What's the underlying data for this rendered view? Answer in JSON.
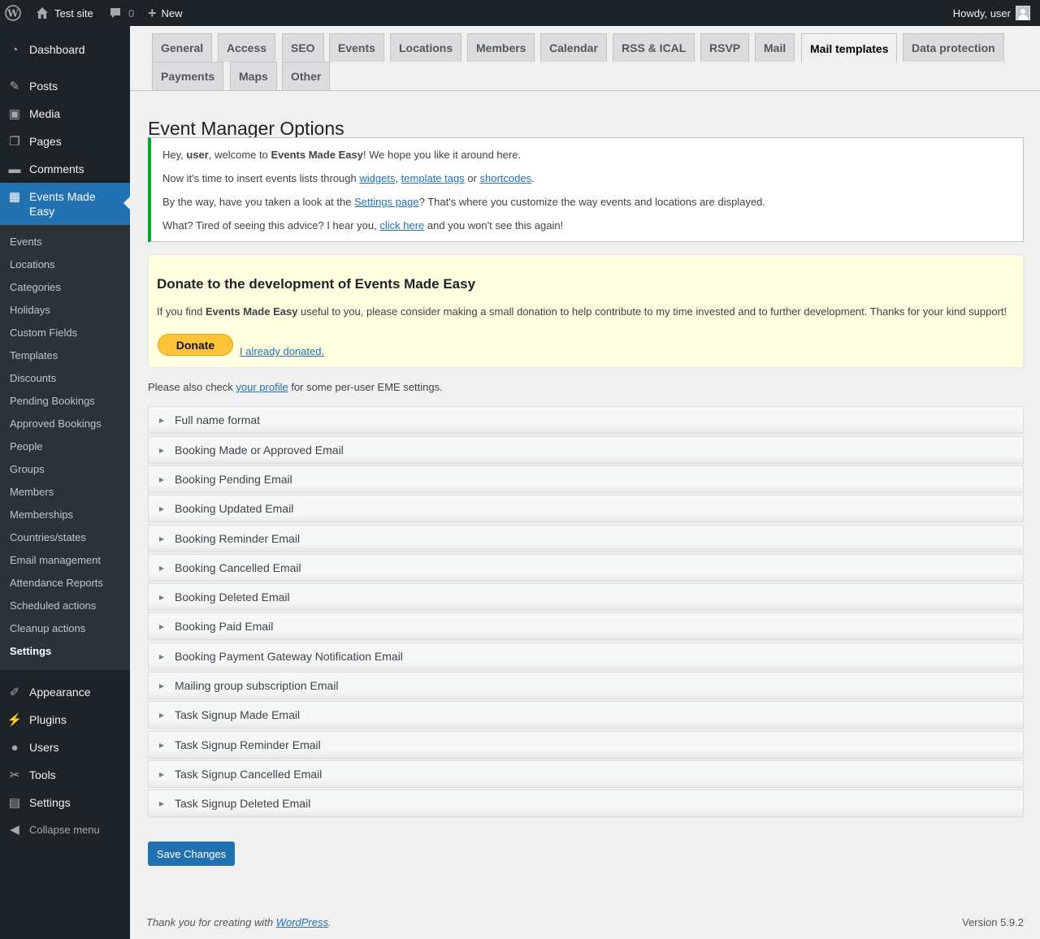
{
  "adminbar": {
    "site_name": "Test site",
    "comments_count": "0",
    "new_label": "New",
    "howdy": "Howdy, user"
  },
  "sidebar": {
    "dashboard": "Dashboard",
    "posts": "Posts",
    "media": "Media",
    "pages": "Pages",
    "comments": "Comments",
    "events_made_easy": "Events Made Easy",
    "submenu": [
      "Events",
      "Locations",
      "Categories",
      "Holidays",
      "Custom Fields",
      "Templates",
      "Discounts",
      "Pending Bookings",
      "Approved Bookings",
      "People",
      "Groups",
      "Members",
      "Memberships",
      "Countries/states",
      "Email management",
      "Attendance Reports",
      "Scheduled actions",
      "Cleanup actions",
      "Settings"
    ],
    "appearance": "Appearance",
    "plugins": "Plugins",
    "users": "Users",
    "tools": "Tools",
    "settings": "Settings",
    "collapse": "Collapse menu"
  },
  "tabs": [
    "General",
    "Access",
    "SEO",
    "Events",
    "Locations",
    "Members",
    "Calendar",
    "RSS & ICAL",
    "RSVP",
    "Mail",
    "Mail templates",
    "Data protection",
    "Payments",
    "Maps",
    "Other"
  ],
  "active_tab": "Mail templates",
  "page_title": "Event Manager Options",
  "notice": {
    "l1_a": "Hey, ",
    "l1_user": "user",
    "l1_b": ", welcome to ",
    "l1_plugin": "Events Made Easy",
    "l1_c": "! We hope you like it around here.",
    "l2_a": "Now it's time to insert events lists through ",
    "l2_link1": "widgets",
    "l2_sep1": ", ",
    "l2_link2": "template tags",
    "l2_sep2": " or ",
    "l2_link3": "shortcodes",
    "l2_end": ".",
    "l3_a": "By the way, have you taken a look at the ",
    "l3_link": "Settings page",
    "l3_b": "? That's where you customize the way events and locations are displayed.",
    "l4_a": "What? Tired of seeing this advice? I hear you, ",
    "l4_link": "click here",
    "l4_b": " and you won't see this again!"
  },
  "donate": {
    "heading": "Donate to the development of Events Made Easy",
    "text_a": "If you find ",
    "text_bold": "Events Made Easy",
    "text_b": " useful to you, please consider making a small donation to help contribute to my time invested and to further development. Thanks for your kind support!",
    "button": "Donate",
    "already": "I already donated."
  },
  "profile_note": {
    "a": "Please also check ",
    "link": "your profile",
    "b": " for some per-user EME settings."
  },
  "sections": [
    "Full name format",
    "Booking Made or Approved Email",
    "Booking Pending Email",
    "Booking Updated Email",
    "Booking Reminder Email",
    "Booking Cancelled Email",
    "Booking Deleted Email",
    "Booking Paid Email",
    "Booking Payment Gateway Notification Email",
    "Mailing group subscription Email",
    "Task Signup Made Email",
    "Task Signup Reminder Email",
    "Task Signup Cancelled Email",
    "Task Signup Deleted Email"
  ],
  "save_button": "Save Changes",
  "footer": {
    "thanks_a": "Thank you for creating with ",
    "thanks_link": "WordPress",
    "thanks_b": ".",
    "version": "Version 5.9.2"
  }
}
